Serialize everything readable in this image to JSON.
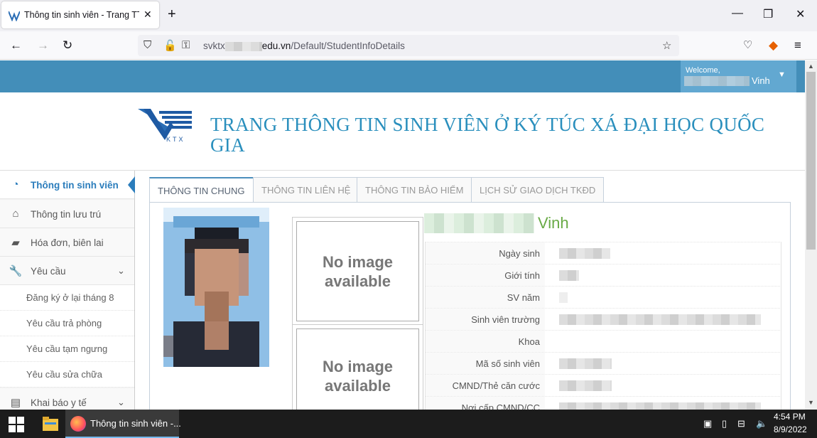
{
  "browser": {
    "tab_title": "Thông tin sinh viên - Trang TTSV",
    "url_prefix": "svktx",
    "url_domain": "edu.vn",
    "url_path": "/Default/StudentInfoDetails",
    "new_tab_icon": "plus-icon",
    "window_controls": [
      "minimize-icon",
      "maximize-icon",
      "close-icon"
    ]
  },
  "header": {
    "welcome": "Welcome,",
    "user_name": "Vinh",
    "logo_text": "KTX",
    "site_title": "TRANG THÔNG TIN SINH VIÊN Ở KÝ TÚC XÁ ĐẠI HỌC QUỐC GIA"
  },
  "sidebar": {
    "items": [
      {
        "label": "Thông tin sinh viên",
        "icon": "dashboard-icon"
      },
      {
        "label": "Thông tin lưu trú",
        "icon": "home-icon"
      },
      {
        "label": "Hóa đơn, biên lai",
        "icon": "book-icon"
      },
      {
        "label": "Yêu cầu",
        "icon": "wrench-icon"
      },
      {
        "label": "Khai báo y tế",
        "icon": "medical-icon"
      }
    ],
    "subitems": [
      {
        "label": "Đăng ký ở lại tháng 8"
      },
      {
        "label": "Yêu cầu trả phòng"
      },
      {
        "label": "Yêu cầu tạm ngưng"
      },
      {
        "label": "Yêu cầu sửa chữa"
      }
    ]
  },
  "tabs": [
    "THÔNG TIN CHUNG",
    "THÔNG TIN LIÊN HỆ",
    "THÔNG TIN BẢO HIỂM",
    "LỊCH SỬ GIAO DỊCH TKĐD"
  ],
  "profile": {
    "name": "Vinh",
    "no_image": "No image available",
    "fields": [
      {
        "label": "Ngày sinh"
      },
      {
        "label": "Giới tính"
      },
      {
        "label": "SV năm"
      },
      {
        "label": "Sinh viên trường"
      },
      {
        "label": "Khoa"
      },
      {
        "label": "Mã số sinh viên"
      },
      {
        "label": "CMND/Thẻ căn cước"
      },
      {
        "label": "Nơi cấp CMND/CC"
      }
    ]
  },
  "taskbar": {
    "app_label": "Thông tin sinh viên -...",
    "time": "4:54 PM",
    "date": "8/9/2022"
  },
  "colors": {
    "accent": "#438eb9",
    "title": "#2a8fbd",
    "name_green": "#69aa46"
  }
}
